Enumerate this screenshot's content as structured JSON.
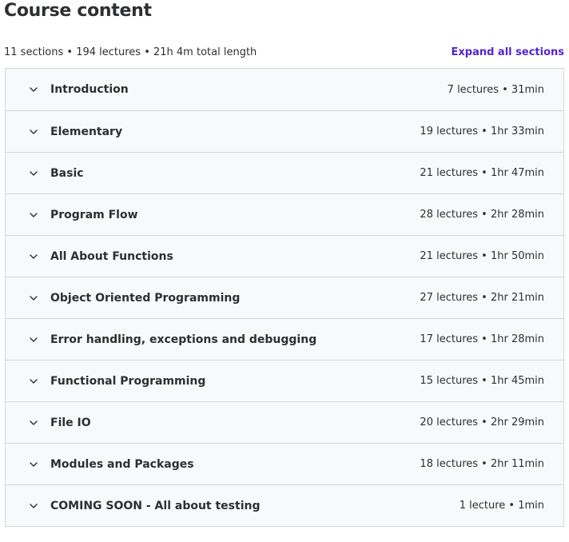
{
  "header": {
    "title": "Course content"
  },
  "summary": {
    "text": "11 sections • 194 lectures • 21h 4m total length",
    "expand_label": "Expand all sections"
  },
  "sections": [
    {
      "title": "Introduction",
      "meta": "7 lectures • 31min"
    },
    {
      "title": "Elementary",
      "meta": "19 lectures • 1hr 33min"
    },
    {
      "title": "Basic",
      "meta": "21 lectures • 1hr 47min"
    },
    {
      "title": "Program Flow",
      "meta": "28 lectures • 2hr 28min"
    },
    {
      "title": "All About Functions",
      "meta": "21 lectures • 1hr 50min"
    },
    {
      "title": "Object Oriented Programming",
      "meta": "27 lectures • 2hr 21min"
    },
    {
      "title": "Error handling, exceptions and debugging",
      "meta": "17 lectures • 1hr 28min"
    },
    {
      "title": "Functional Programming",
      "meta": "15 lectures • 1hr 45min"
    },
    {
      "title": "File IO",
      "meta": "20 lectures • 2hr 29min"
    },
    {
      "title": "Modules and Packages",
      "meta": "18 lectures • 2hr 11min"
    },
    {
      "title": "COMING SOON - All about testing",
      "meta": "1 lecture • 1min"
    }
  ],
  "icons": {
    "chevron": "chevron-down-icon"
  },
  "colors": {
    "accent": "#5624d0",
    "text": "#2d2f31",
    "row_bg": "#f7f9fa",
    "border": "#d1d7dc"
  }
}
